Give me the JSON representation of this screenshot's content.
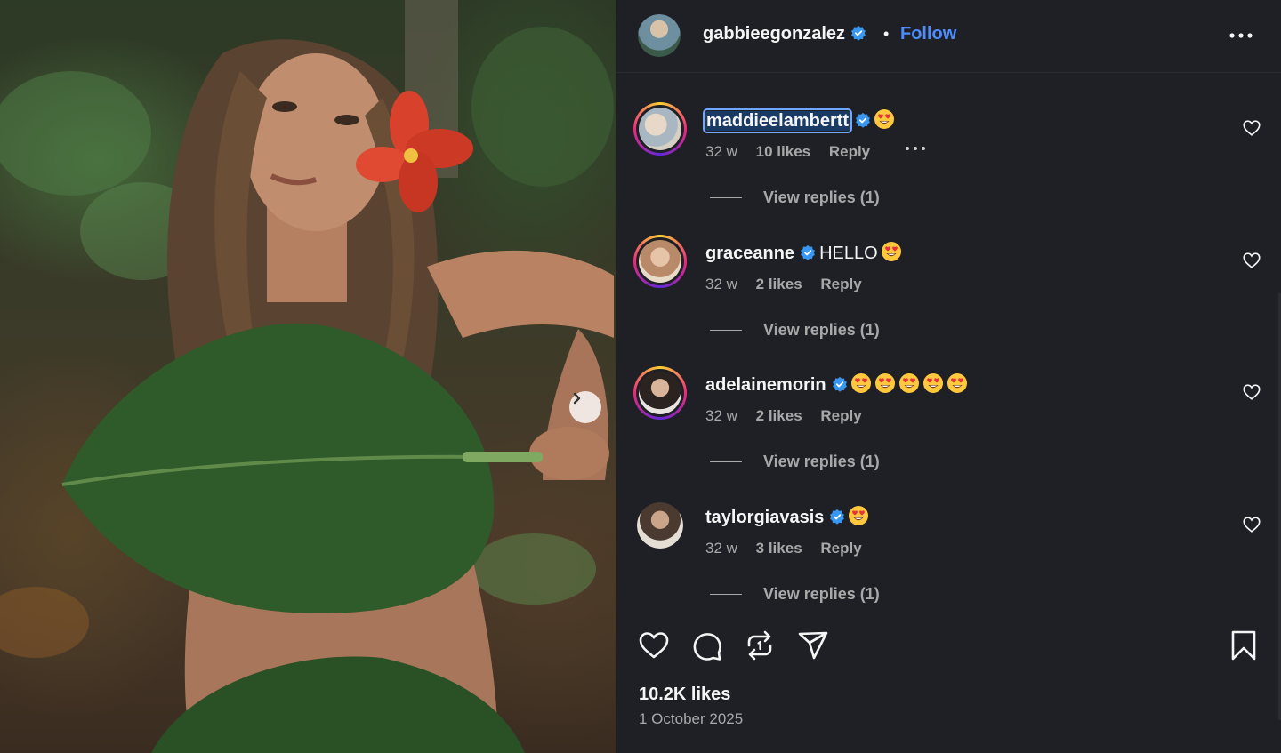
{
  "post": {
    "owner": "gabbieegonzalez",
    "separator": "•",
    "follow_label": "Follow",
    "likes": "10.2K likes",
    "date": "1 October 2025"
  },
  "comments": [
    {
      "user": "maddieelambertt",
      "text": "",
      "emoji_count": 1,
      "age": "32 w",
      "likes": "10 likes",
      "reply": "Reply",
      "view_replies": "View replies (1)",
      "selected": true,
      "ring": true
    },
    {
      "user": "graceanne",
      "text": "HELLO",
      "emoji_count": 1,
      "age": "32 w",
      "likes": "2 likes",
      "reply": "Reply",
      "view_replies": "View replies (1)",
      "selected": false,
      "ring": true
    },
    {
      "user": "adelainemorin",
      "text": "",
      "emoji_count": 5,
      "age": "32 w",
      "likes": "2 likes",
      "reply": "Reply",
      "view_replies": "View replies (1)",
      "selected": false,
      "ring": true
    },
    {
      "user": "taylorgiavasis",
      "text": "",
      "emoji_count": 1,
      "age": "32 w",
      "likes": "3 likes",
      "reply": "Reply",
      "view_replies": "View replies (1)",
      "selected": false,
      "ring": false
    }
  ],
  "icons": {
    "verified": "verified-badge-icon",
    "emoji": "heart-eyes-emoji-icon",
    "like": "heart-icon",
    "comment": "comment-icon",
    "repost": "repost-icon",
    "share": "share-icon",
    "save": "bookmark-icon",
    "more": "more-horizontal-icon",
    "next": "chevron-right-icon"
  },
  "colors": {
    "panel_bg": "#1f2026",
    "accent_follow": "#4d8cff",
    "verified_blue": "#3897f0",
    "muted_text": "#a8a8a8"
  }
}
